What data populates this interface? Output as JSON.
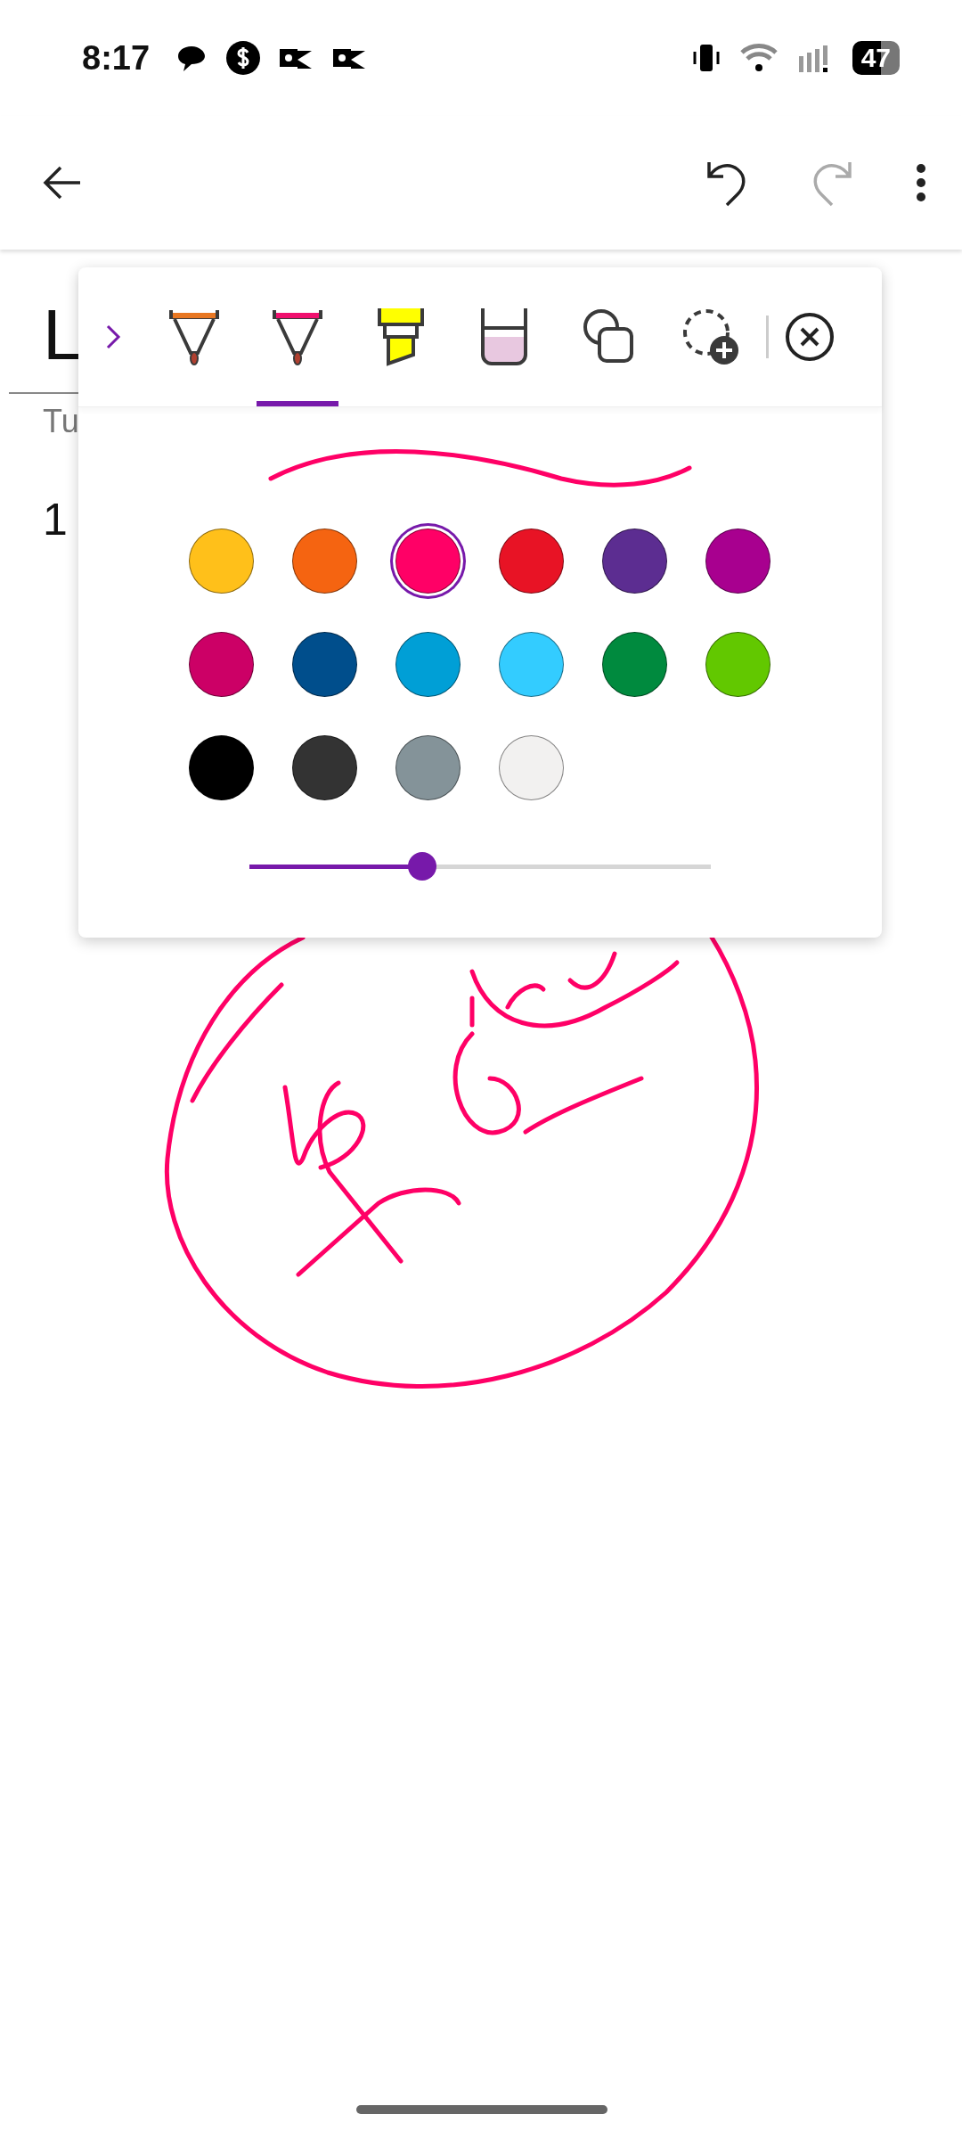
{
  "status_bar": {
    "time": "8:17",
    "battery": "47"
  },
  "page": {
    "title": "L",
    "date": "Tu",
    "body": "1"
  },
  "pen_panel": {
    "tools": [
      {
        "kind": "pen",
        "color": "#e87722",
        "selected": false
      },
      {
        "kind": "pen",
        "color": "#f0106e",
        "selected": true
      },
      {
        "kind": "highlighter",
        "color": "#ffff00",
        "selected": false
      },
      {
        "kind": "beaker",
        "color": "#e8c8e0",
        "selected": false
      },
      {
        "kind": "shapes",
        "selected": false
      },
      {
        "kind": "lasso-add",
        "selected": false
      }
    ],
    "colors": [
      {
        "color": "#ffc01a",
        "selected": false
      },
      {
        "color": "#f56411",
        "selected": false
      },
      {
        "color": "#ff0066",
        "selected": true
      },
      {
        "color": "#e81325",
        "selected": false
      },
      {
        "color": "#5c2d91",
        "selected": false
      },
      {
        "color": "#a8008f",
        "selected": false
      },
      {
        "color": "#cc0066",
        "selected": false
      },
      {
        "color": "#004e8c",
        "selected": false
      },
      {
        "color": "#009fd6",
        "selected": false
      },
      {
        "color": "#33ccff",
        "selected": false
      },
      {
        "color": "#008a3e",
        "selected": false
      },
      {
        "color": "#62c800",
        "selected": false
      },
      {
        "color": "#000000",
        "selected": false
      },
      {
        "color": "#333333",
        "selected": false
      },
      {
        "color": "#849399",
        "selected": false
      },
      {
        "color": "#f2f1f0",
        "selected": false
      }
    ],
    "thickness": {
      "level": 0.375
    }
  }
}
